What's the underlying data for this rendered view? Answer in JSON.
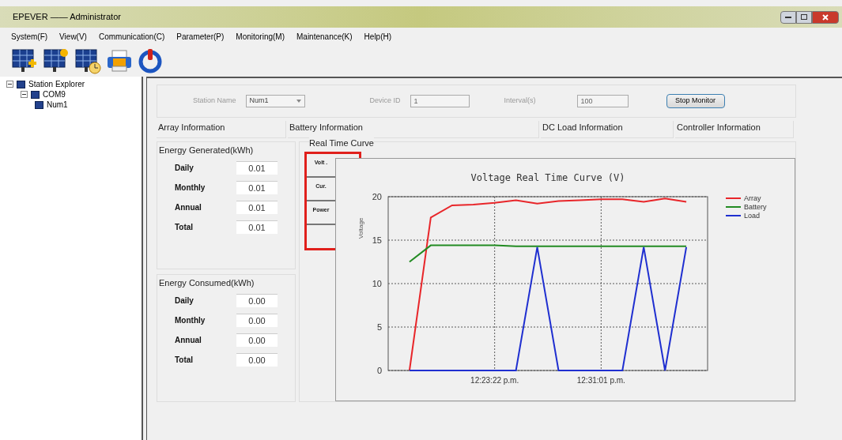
{
  "window": {
    "title": "EPEVER —— Administrator"
  },
  "menu": [
    "System(F)",
    "View(V)",
    "Communication(C)",
    "Parameter(P)",
    "Monitoring(M)",
    "Maintenance(K)",
    "Help(H)"
  ],
  "tree": [
    {
      "label": "Station Explorer",
      "expanded": true,
      "children": [
        {
          "label": "COM9",
          "expanded": true,
          "children": [
            {
              "label": "Num1"
            }
          ]
        }
      ]
    }
  ],
  "station": {
    "name_label": "Station Name",
    "name_value": "Num1",
    "device_label": "Device ID",
    "device_value": "1",
    "interval_label": "Interval(s)",
    "interval_value": "100",
    "button": "Stop Monitor"
  },
  "info_tabs": [
    "Array Information",
    "Battery Information",
    "DC Load Information",
    "Controller Information"
  ],
  "energy_groups": [
    {
      "title": "Energy Generated(kWh)",
      "rows": [
        {
          "label": "Daily",
          "value": "0.01"
        },
        {
          "label": "Monthly",
          "value": "0.01"
        },
        {
          "label": "Annual",
          "value": "0.01"
        },
        {
          "label": "Total",
          "value": "0.01"
        }
      ]
    },
    {
      "title": "Energy Consumed(kWh)",
      "rows": [
        {
          "label": "Daily",
          "value": "0.00"
        },
        {
          "label": "Monthly",
          "value": "0.00"
        },
        {
          "label": "Annual",
          "value": "0.00"
        },
        {
          "label": "Total",
          "value": "0.00"
        }
      ]
    }
  ],
  "curve": {
    "title": "Real Time Curve",
    "tabs": [
      {
        "label": "Volt ."
      },
      {
        "label": "Cur."
      },
      {
        "label": "Power"
      }
    ],
    "chart_data": {
      "type": "line",
      "title": "Voltage Real Time Curve (V)",
      "ylabel": "Voltage",
      "categories": [
        null,
        null,
        null,
        null,
        "12:23:22 p.m.",
        null,
        null,
        null,
        null,
        "12:31:01 p.m.",
        null,
        null,
        null,
        null
      ],
      "ylim": [
        0,
        20
      ],
      "grid": true,
      "legend": true,
      "yticks": [
        0,
        5,
        10,
        15,
        20
      ],
      "series": [
        {
          "name": "Array",
          "color": "#e8262a",
          "values": [
            0,
            17.6,
            19.0,
            19.1,
            19.3,
            19.6,
            19.2,
            19.5,
            19.6,
            19.7,
            19.7,
            19.4,
            19.8,
            19.4
          ]
        },
        {
          "name": "Battery",
          "color": "#228b22",
          "values": [
            12.5,
            14.4,
            14.4,
            14.4,
            14.4,
            14.3,
            14.3,
            14.3,
            14.3,
            14.3,
            14.3,
            14.3,
            14.3,
            14.3
          ]
        },
        {
          "name": "Load",
          "color": "#1f2fd0",
          "values": [
            0,
            0,
            0,
            0,
            0,
            0,
            14.2,
            0,
            0,
            0,
            0,
            14.2,
            0,
            14.2
          ]
        }
      ]
    }
  }
}
